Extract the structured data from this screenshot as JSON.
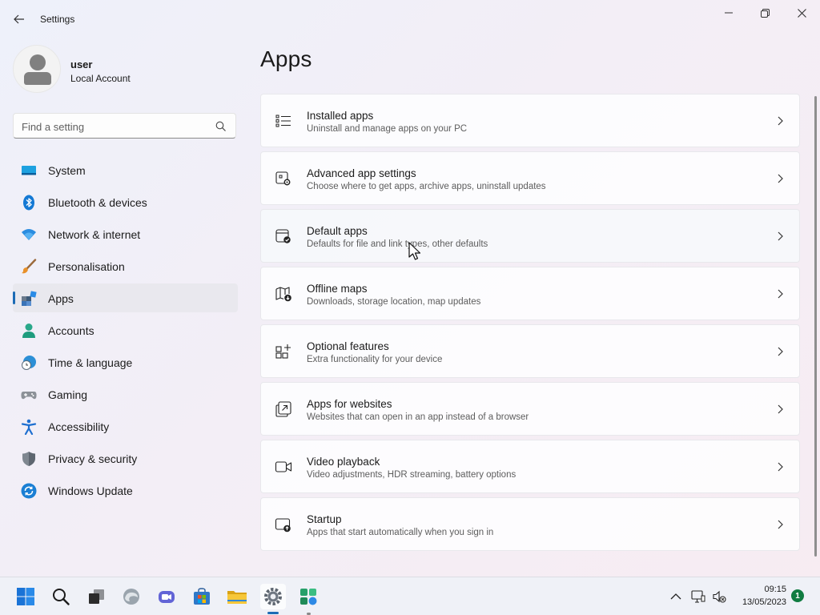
{
  "window": {
    "title": "Settings",
    "controls": [
      "minimize",
      "restore",
      "close"
    ]
  },
  "profile": {
    "name": "user",
    "account_type": "Local Account"
  },
  "search": {
    "placeholder": "Find a setting"
  },
  "sidebar": {
    "selected": "Apps",
    "items": [
      {
        "label": "System",
        "icon": "system-icon"
      },
      {
        "label": "Bluetooth & devices",
        "icon": "bluetooth-icon"
      },
      {
        "label": "Network & internet",
        "icon": "wifi-icon"
      },
      {
        "label": "Personalisation",
        "icon": "brush-icon"
      },
      {
        "label": "Apps",
        "icon": "apps-icon"
      },
      {
        "label": "Accounts",
        "icon": "accounts-icon"
      },
      {
        "label": "Time & language",
        "icon": "globe-clock-icon"
      },
      {
        "label": "Gaming",
        "icon": "gamepad-icon"
      },
      {
        "label": "Accessibility",
        "icon": "accessibility-icon"
      },
      {
        "label": "Privacy & security",
        "icon": "shield-icon"
      },
      {
        "label": "Windows Update",
        "icon": "update-icon"
      }
    ]
  },
  "main": {
    "title": "Apps",
    "cards": [
      {
        "title": "Installed apps",
        "desc": "Uninstall and manage apps on your PC",
        "icon": "list-icon"
      },
      {
        "title": "Advanced app settings",
        "desc": "Choose where to get apps, archive apps, uninstall updates",
        "icon": "app-settings-icon"
      },
      {
        "title": "Default apps",
        "desc": "Defaults for file and link types, other defaults",
        "icon": "default-apps-icon"
      },
      {
        "title": "Offline maps",
        "desc": "Downloads, storage location, map updates",
        "icon": "map-download-icon"
      },
      {
        "title": "Optional features",
        "desc": "Extra functionality for your device",
        "icon": "add-grid-icon"
      },
      {
        "title": "Apps for websites",
        "desc": "Websites that can open in an app instead of a browser",
        "icon": "open-external-icon"
      },
      {
        "title": "Video playback",
        "desc": "Video adjustments, HDR streaming, battery options",
        "icon": "video-icon"
      },
      {
        "title": "Startup",
        "desc": "Apps that start automatically when you sign in",
        "icon": "startup-icon"
      }
    ]
  },
  "taskbar": {
    "apps": [
      "start-icon",
      "search-icon",
      "task-view-icon",
      "edge-icon",
      "teams-icon",
      "store-icon",
      "file-explorer-icon",
      "settings-icon",
      "app-icon"
    ],
    "active_app": "settings-icon",
    "tray": [
      "chevron-up-icon",
      "network-icon",
      "volume-muted-icon"
    ],
    "time": "09:15",
    "date": "13/05/2023",
    "notification_count": "1"
  },
  "colors": {
    "accent": "#1c6bb5",
    "badge": "#107c41"
  }
}
